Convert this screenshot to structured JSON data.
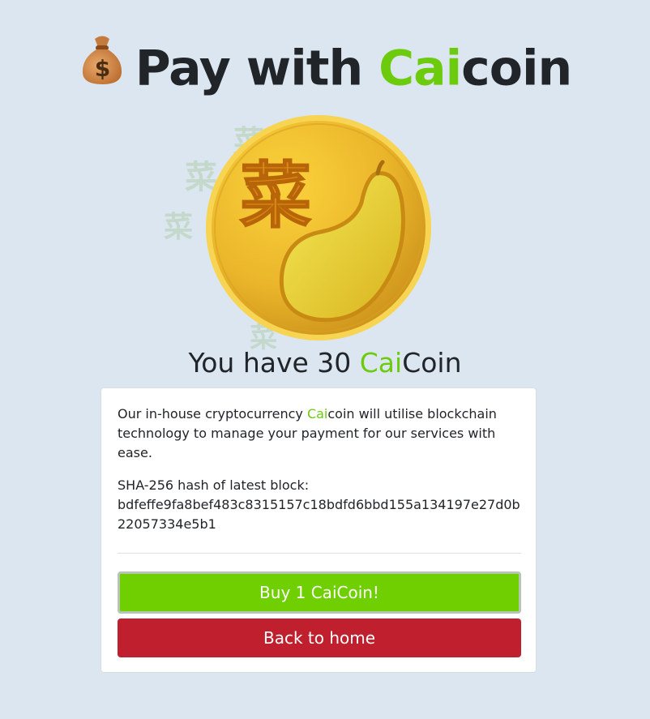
{
  "header": {
    "icon": "money-bag-emoji",
    "title_prefix": "Pay with ",
    "brand_highlight": "Cai",
    "brand_rest": "coin"
  },
  "coin": {
    "icon": "caicoin-coin-icon",
    "glyph": "菜",
    "colors": {
      "gold": "#f2c233",
      "rim": "#f7d451",
      "dark_gold": "#c9951a",
      "pear": "#e8d63a"
    }
  },
  "balance": {
    "prefix": "You have 30 ",
    "highlight": "Cai",
    "suffix": "Coin"
  },
  "card": {
    "desc_before": "Our in-house cryptocurrency ",
    "desc_highlight": "Cai",
    "desc_after": "coin will utilise blockchain technology to manage your payment for our services with ease.",
    "hash_label": "SHA-256 hash of latest block:",
    "hash_value": "bdfeffe9fa8bef483c8315157c18bdfd6bbd155a134197e27d0b22057334e5b1",
    "buy_button": "Buy 1 CaiCoin!",
    "home_button": "Back to home"
  },
  "colors": {
    "background": "#dce6f0",
    "brand_green": "#6bcb0c",
    "buy_green": "#6fcf01",
    "home_red": "#c0202e"
  }
}
